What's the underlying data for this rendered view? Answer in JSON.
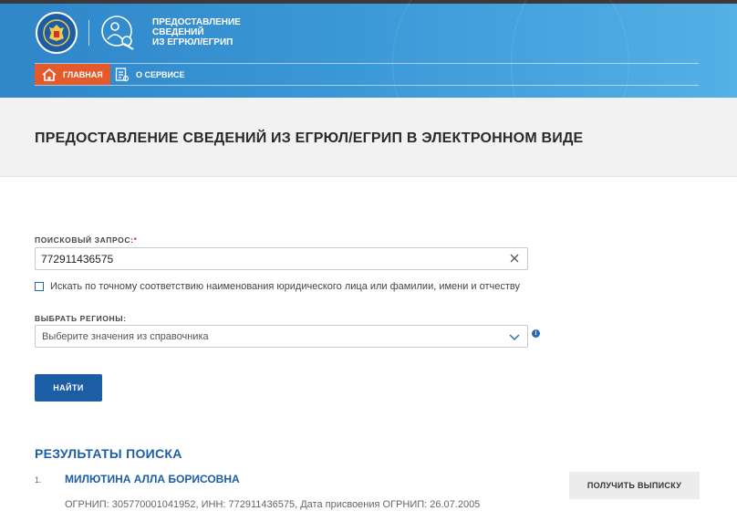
{
  "header": {
    "service_title_line1": "ПРЕДОСТАВЛЕНИЕ",
    "service_title_line2": "СВЕДЕНИЙ",
    "service_title_line3": "ИЗ ЕГРЮЛ/ЕГРИП",
    "emblem_icon": "fns-emblem-icon",
    "service_icon": "person-gear-icon"
  },
  "nav": {
    "items": [
      {
        "label": "ГЛАВНАЯ",
        "icon": "home-icon",
        "active": true
      },
      {
        "label": "О СЕРВИСЕ",
        "icon": "document-icon",
        "active": false
      }
    ]
  },
  "page": {
    "title": "ПРЕДОСТАВЛЕНИЕ СВЕДЕНИЙ ИЗ ЕГРЮЛ/ЕГРИП В ЭЛЕКТРОННОМ ВИДЕ"
  },
  "form": {
    "query_label": "ПОИСКОВЫЙ ЗАПРОС:",
    "required_mark": "*",
    "query_value": "772911436575",
    "exact_match_label": "Искать по точному соответствию наименования юридического лица или фамилии, имени и отчеству",
    "exact_match_checked": false,
    "regions_label": "ВЫБРАТЬ РЕГИОНЫ:",
    "regions_placeholder": "Выберите значения из справочника",
    "info_glyph": "i",
    "find_button": "НАЙТИ"
  },
  "results": {
    "title": "РЕЗУЛЬТАТЫ ПОИСКА",
    "items": [
      {
        "number": "1.",
        "name": "МИЛЮТИНА АЛЛА БОРИСОВНА",
        "meta": "ОГРНИП: 305770001041952, ИНН: 772911436575, Дата присвоения ОГРНИП: 26.07.2005",
        "action": "ПОЛУЧИТЬ ВЫПИСКУ"
      }
    ]
  },
  "colors": {
    "header_blue": "#2f86c8",
    "accent_orange": "#e45a2b",
    "link_blue": "#1c5ea6",
    "required_red": "#e3342f"
  }
}
